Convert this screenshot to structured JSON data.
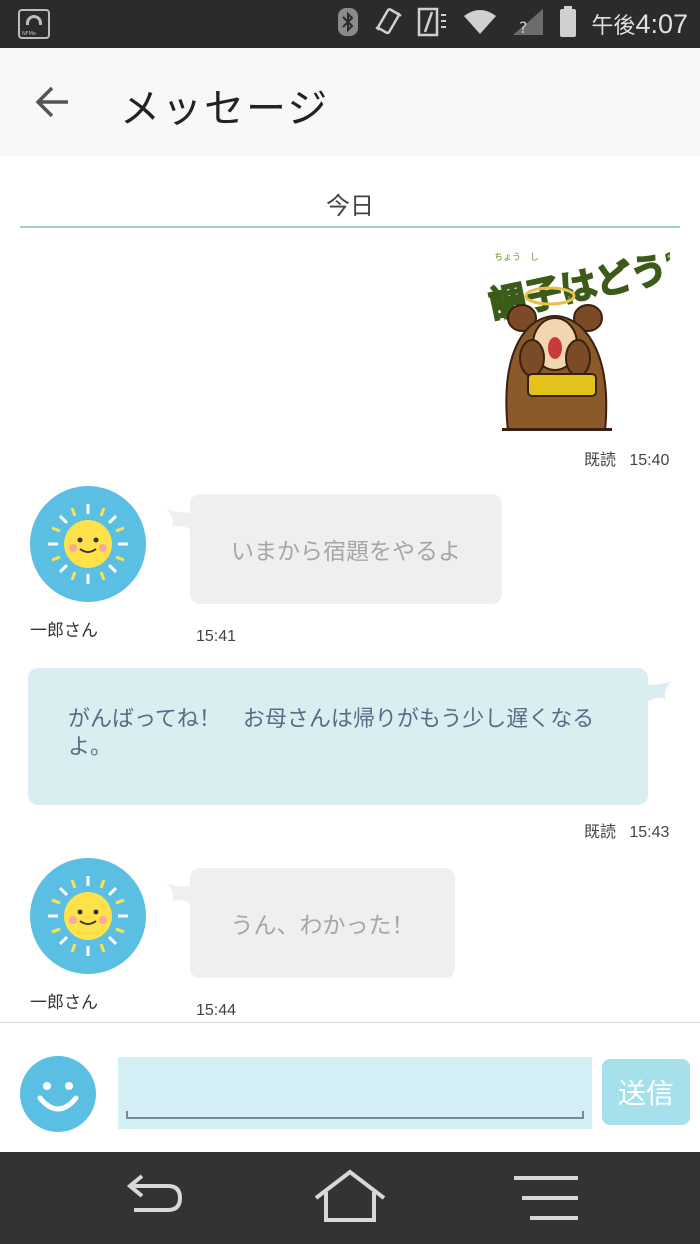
{
  "status_bar": {
    "nfc_label": "NFMe",
    "time_prefix": "午後",
    "time": "4:07",
    "icons": [
      "nfc-icon",
      "bluetooth-icon",
      "vibrate-icon",
      "battery-saver-icon",
      "wifi-icon",
      "signal-icon",
      "battery-icon"
    ]
  },
  "header": {
    "title": "メッセージ",
    "back_icon": "arrow-left-icon"
  },
  "conversation": {
    "date_label": "今日",
    "sticker": {
      "text": "調子はどう?",
      "ruby": "ちょう　し"
    },
    "messages": [
      {
        "type": "sticker",
        "read_label": "既読",
        "time": "15:40"
      },
      {
        "type": "incoming",
        "sender": "一郎さん",
        "text": "いまから宿題をやるよ",
        "time": "15:41"
      },
      {
        "type": "outgoing",
        "text": "がんばってね！　お母さんは帰りがもう少し遅くなるよ。",
        "read_label": "既読",
        "time": "15:43"
      },
      {
        "type": "incoming",
        "sender": "一郎さん",
        "text": "うん、わかった！",
        "time": "15:44"
      }
    ]
  },
  "composer": {
    "input_value": "",
    "input_placeholder": "",
    "send_label": "送信",
    "emoji_icon": "smiley-icon"
  },
  "nav": {
    "buttons": [
      "back-nav-icon",
      "home-icon",
      "menu-icon"
    ]
  },
  "colors": {
    "accent": "#5bbfe4",
    "outgoing_bubble": "#daeef2",
    "incoming_bubble": "#efefef",
    "input_bg": "#d4f0f6",
    "send_button": "#a6e0ea"
  }
}
